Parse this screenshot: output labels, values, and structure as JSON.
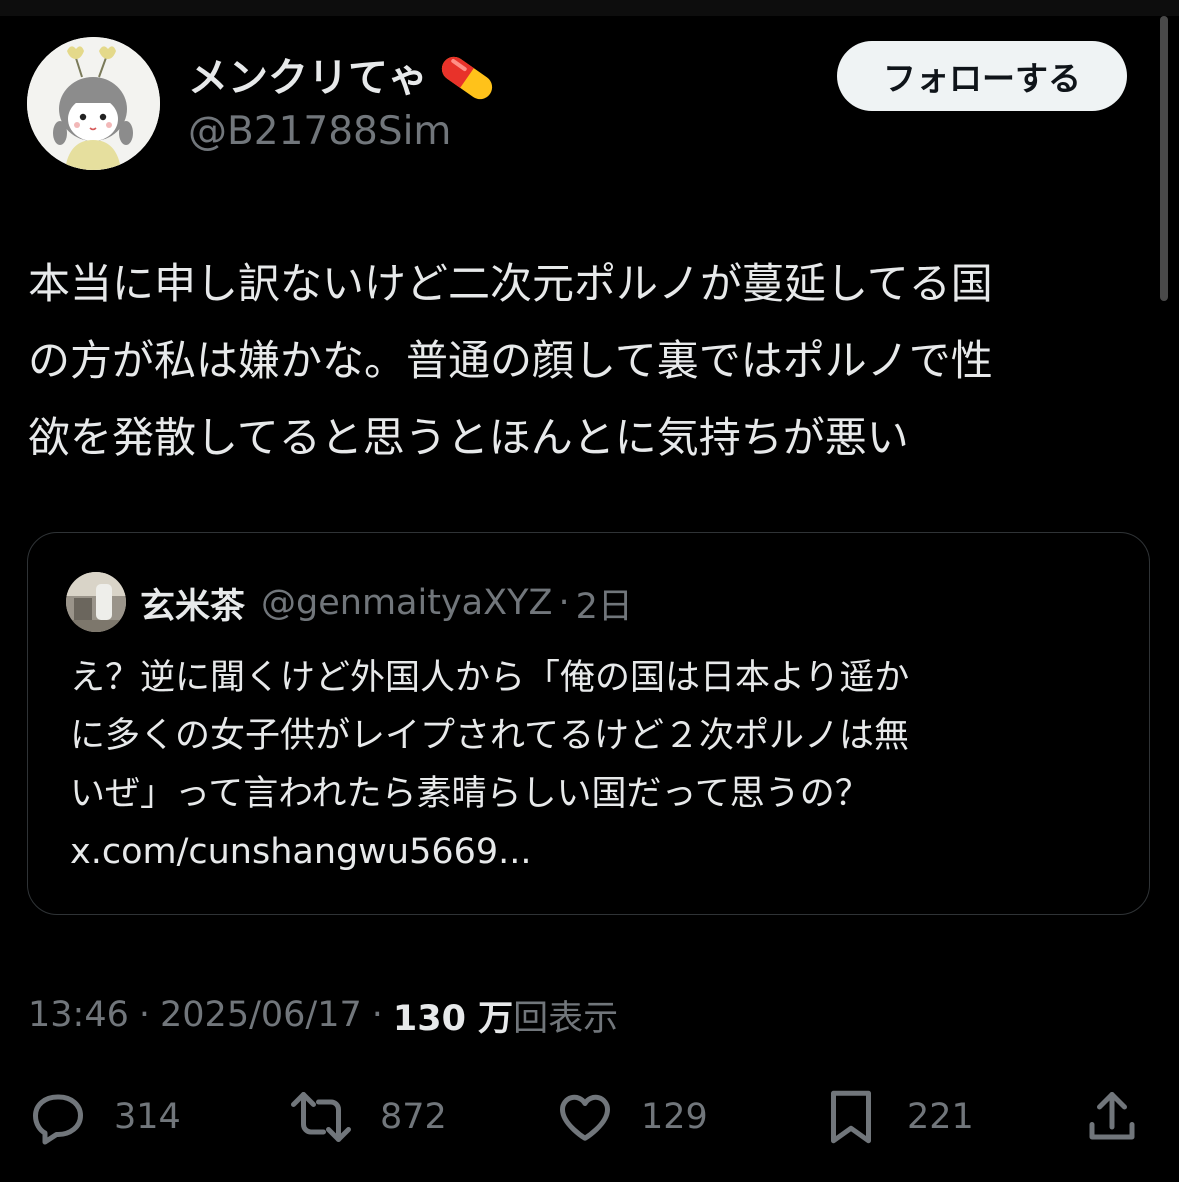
{
  "post": {
    "author": {
      "display_name": "メンクリてゃ",
      "name_emoji_icon": "pill-icon",
      "handle": "@B21788Sim",
      "avatar_icon": "avatar-illustration"
    },
    "follow_label": "フォローする",
    "text_lines": [
      "本当に申し訳ないけど二次元ポルノが蔓延してる国",
      "の方が私は嫌かな。普通の顔して裏ではポルノで性",
      "欲を発散してると思うとほんとに気持ちが悪い"
    ],
    "quote": {
      "display_name": "玄米茶",
      "handle": "@genmaityaXYZ",
      "separator": "·",
      "time": "2日",
      "text_lines": [
        "え？逆に聞くけど外国人から「俺の国は日本より遥か",
        "に多くの女子供がレイプされてるけど２次ポルノは無",
        "いぜ」って言われたら素晴らしい国だって思うの？",
        "x.com/cunshangwu5669..."
      ]
    },
    "meta": {
      "time": "13:46",
      "sep1": "·",
      "date": "2025/06/17",
      "sep2": "·",
      "views_count": "130 万",
      "views_label": "回表示"
    },
    "actions": {
      "reply": {
        "icon": "reply-icon",
        "count": "314"
      },
      "repost": {
        "icon": "repost-icon",
        "count": "872"
      },
      "like": {
        "icon": "heart-icon",
        "count": "129"
      },
      "bookmark": {
        "icon": "bookmark-icon",
        "count": "221"
      },
      "share": {
        "icon": "share-icon"
      }
    }
  },
  "colors": {
    "background": "#000000",
    "text_primary": "#e7e9ea",
    "text_secondary": "#71767b",
    "border": "#2f3336",
    "button_bg": "#eff3f4",
    "button_text": "#0f1419"
  }
}
